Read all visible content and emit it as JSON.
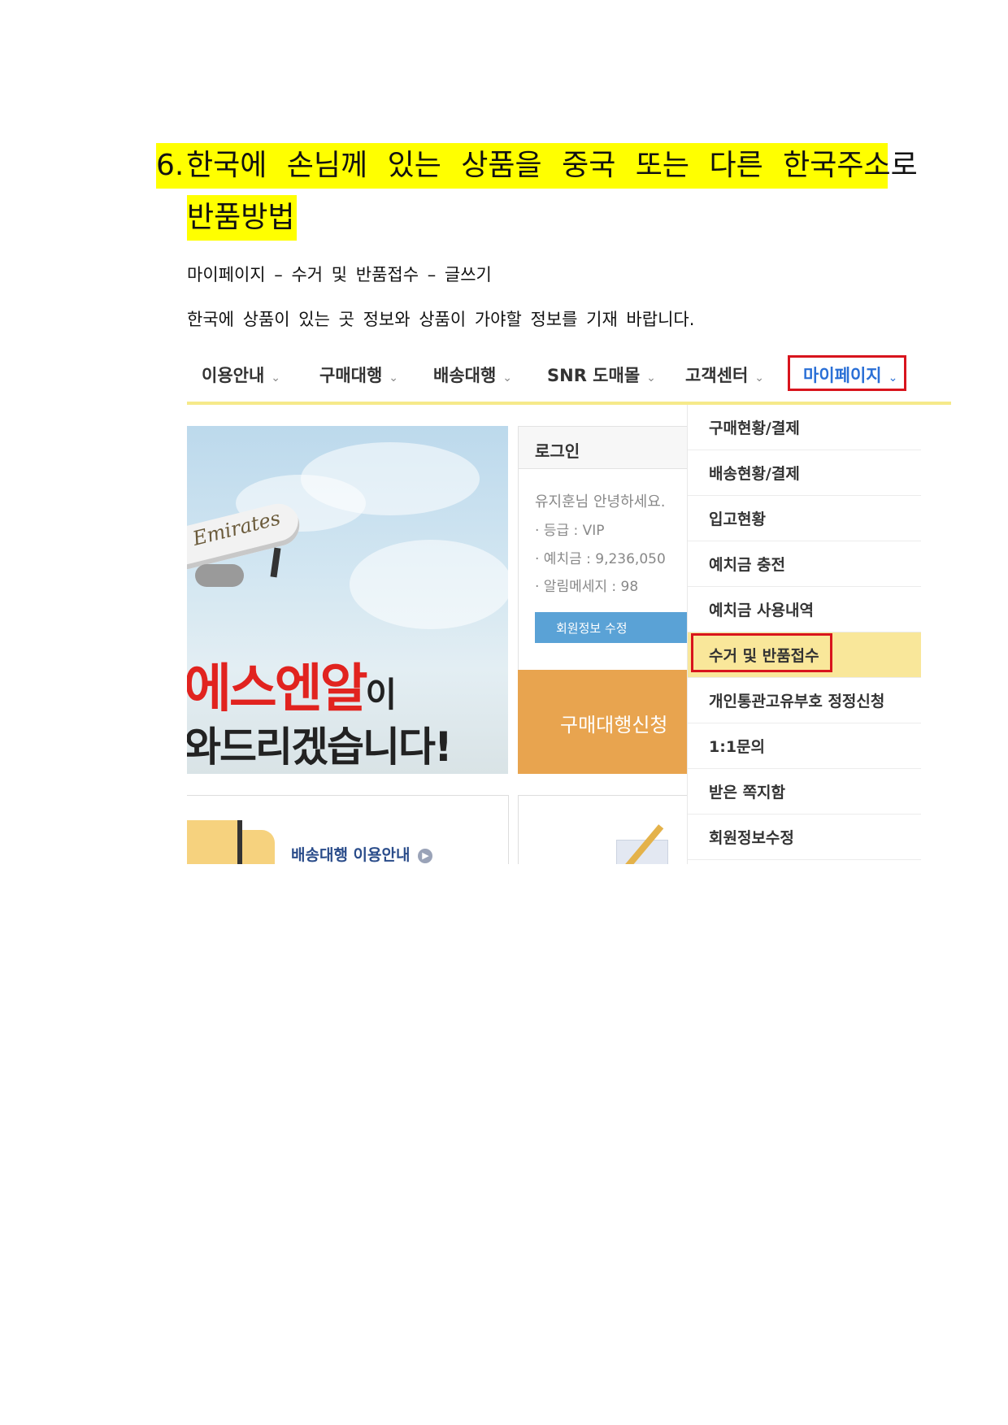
{
  "document": {
    "heading_number": "6.",
    "heading_line1": "한국에 손님께 있는 상품을 중국 또는 다른 한국주소로",
    "heading_line2": "반품방법",
    "path_text": "마이페이지 – 수거 및 반품접수 – 글쓰기",
    "instruction_text": "한국에 상품이 있는 곳 정보와 상품이 가야할 정보를 기재 바랍니다."
  },
  "screenshot": {
    "nav": [
      {
        "label": "이용안내"
      },
      {
        "label": "구매대행"
      },
      {
        "label": "배송대행"
      },
      {
        "label": "SNR 도매몰"
      },
      {
        "label": "고객센터"
      },
      {
        "label": "마이페이지"
      }
    ],
    "nav_chevron": "⌄",
    "banner": {
      "plane_text": "Emirates",
      "title": "에스엔알",
      "title_suffix": "이",
      "subtitle": "와드리겠습니다!"
    },
    "login": {
      "heading": "로그인",
      "welcome": "유지훈님 안녕하세요.",
      "grade": "· 등급 : VIP",
      "deposit": "· 예치금 : 9,236,050",
      "alerts": "· 알림메세지 : 98",
      "edit_button": "회원정보 수정"
    },
    "apply_label": "구매대행신청",
    "bottom_box1_label": "배송대행 이용안내",
    "dropdown": [
      {
        "label": "구매현황/결제"
      },
      {
        "label": "배송현황/결제"
      },
      {
        "label": "입고현황"
      },
      {
        "label": "예치금 충전"
      },
      {
        "label": "예치금 사용내역"
      },
      {
        "label": "수거 및 반품접수",
        "active": true
      },
      {
        "label": "개인통관고유부호 정정신청"
      },
      {
        "label": "1:1문의"
      },
      {
        "label": "받은 쪽지함"
      },
      {
        "label": "회원정보수정"
      }
    ],
    "colors": {
      "highlight": "#ffff00",
      "nav_active": "#2a6fd6",
      "callout_border": "#d8141d",
      "apply_bg": "#e8a44f",
      "edit_button_bg": "#5aa2d6",
      "active_item_bg": "#f9e79a"
    }
  }
}
